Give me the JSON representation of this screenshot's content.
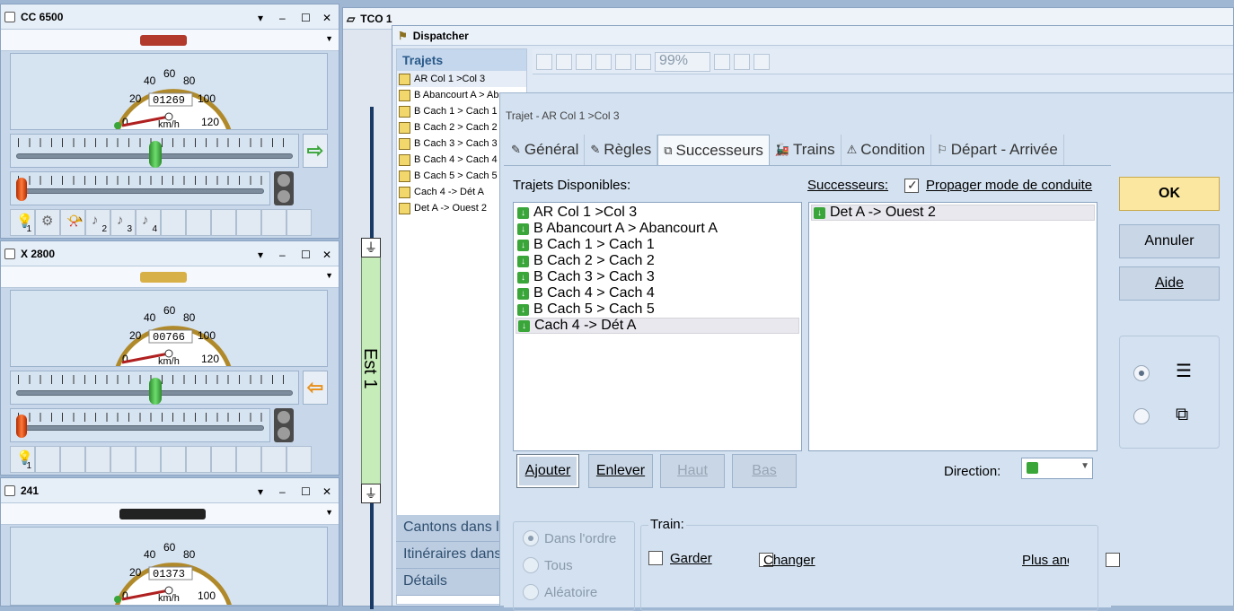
{
  "locos": [
    {
      "name": "CC 6500",
      "counter": "01269",
      "dir_arrow": "⇨",
      "functions": [
        "1",
        "",
        "",
        "2",
        "3",
        "4"
      ],
      "train_color": "#b23a2c"
    },
    {
      "name": "X 2800",
      "counter": "00766",
      "dir_arrow": "⇦",
      "functions": [
        "1"
      ],
      "train_color": "#d8b048"
    },
    {
      "name": "241",
      "counter": "01373"
    }
  ],
  "gauge": {
    "ticks": [
      "0",
      "20",
      "40",
      "60",
      "80",
      "100",
      "120"
    ],
    "unit": "km/h"
  },
  "tco": {
    "title": "TCO 1",
    "track_label": "Est 1"
  },
  "dispatcher": {
    "title": "Dispatcher",
    "trajets_header": "Trajets",
    "trajets": [
      "AR Col 1 >Col 3",
      "B Abancourt A > Abancourt A",
      "B Cach 1 > Cach 1",
      "B Cach 2 > Cach 2",
      "B Cach 3 > Cach 3",
      "B Cach 4 > Cach 4",
      "B Cach 5 > Cach 5",
      "Cach 4 -> Dét A",
      "Det A -> Ouest 2"
    ],
    "zoom": "99%",
    "bottom_tabs": [
      "Cantons dans le TCO",
      "Itinéraires dans le TCO",
      "Détails"
    ]
  },
  "dialog": {
    "title": "Trajet - AR Col 1 >Col 3",
    "tabs": [
      {
        "label": "Général",
        "icon": "general-icon"
      },
      {
        "label": "Règles",
        "icon": "rules-icon"
      },
      {
        "label": "Successeurs",
        "icon": "successors-icon"
      },
      {
        "label": "Trains",
        "icon": "trains-icon"
      },
      {
        "label": "Condition",
        "icon": "condition-icon"
      },
      {
        "label": "Départ - Arrivée",
        "icon": "departure-arrival-icon"
      }
    ],
    "available_label": "Trajets Disponibles:",
    "available": [
      "AR Col 1 >Col 3",
      "B Abancourt A > Abancourt A",
      "B Cach 1 > Cach 1",
      "B Cach 2 > Cach 2",
      "B Cach 3 > Cach 3",
      "B Cach 4 > Cach 4",
      "B Cach 5 > Cach 5",
      "Cach 4 -> Dét A"
    ],
    "successors_label": "Successeurs:",
    "propagate_label": "Propager mode de conduite",
    "successors": [
      "Det A -> Ouest 2"
    ],
    "buttons": {
      "add": "Ajouter",
      "remove": "Enlever",
      "up": "Haut",
      "down": "Bas",
      "ok": "OK",
      "cancel": "Annuler",
      "help": "Aide"
    },
    "direction_label": "Direction:",
    "order_options": [
      "Dans l'ordre",
      "Tous",
      "Aléatoire"
    ],
    "train_group_label": "Train:",
    "keep_label": "Garder",
    "change_label": "Changer",
    "plus_label": "Plus anc"
  }
}
